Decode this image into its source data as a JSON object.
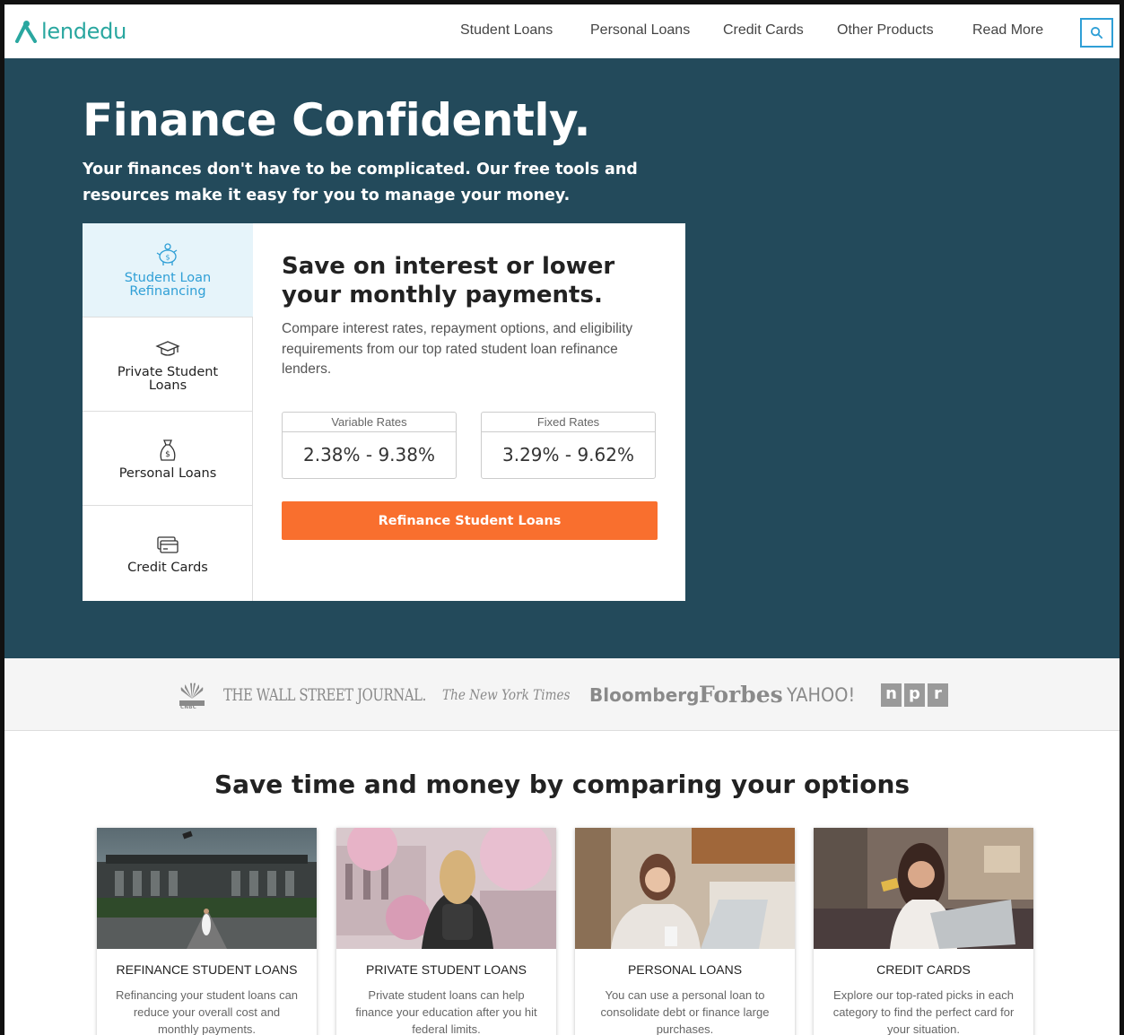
{
  "brand": {
    "name": "lendedu",
    "color": "#2aa7a0"
  },
  "nav": {
    "items": [
      "Student Loans",
      "Personal Loans",
      "Credit Cards",
      "Other Products",
      "Read More"
    ],
    "search_icon": "search-icon"
  },
  "hero": {
    "title": "Finance Confidently.",
    "subtitle_line1": "Your finances don't have to be complicated. Our free tools and",
    "subtitle_line2": "resources make it easy for you to manage your money.",
    "background": "#234a5b"
  },
  "widget": {
    "tabs": [
      {
        "label": "Student Loan Refinancing",
        "icon": "piggy-bank-icon",
        "active": true
      },
      {
        "label": "Private Student Loans",
        "icon": "graduation-cap-icon",
        "active": false
      },
      {
        "label": "Personal Loans",
        "icon": "money-bag-icon",
        "active": false
      },
      {
        "label": "Credit Cards",
        "icon": "credit-card-icon",
        "active": false
      }
    ],
    "panel": {
      "title": "Save on interest or lower your monthly payments.",
      "description": "Compare interest rates, repayment options, and eligibility requirements from our top rated student loan refinance lenders.",
      "rates": [
        {
          "label": "Variable Rates",
          "value": "2.38% - 9.38%"
        },
        {
          "label": "Fixed Rates",
          "value": "3.29% - 9.62%"
        }
      ],
      "cta": "Refinance Student Loans",
      "cta_color": "#f96f2e"
    }
  },
  "press": {
    "logos": [
      "CNBC",
      "THE WALL STREET JOURNAL.",
      "The New York Times",
      "Bloomberg",
      "Forbes",
      "YAHOO!",
      "npr"
    ]
  },
  "compare": {
    "title": "Save time and money by comparing your options",
    "cards": [
      {
        "title": "REFINANCE STUDENT LOANS",
        "desc": "Refinancing your student loans can reduce your overall cost and monthly payments."
      },
      {
        "title": "PRIVATE STUDENT LOANS",
        "desc": "Private student loans can help finance your education after you hit federal limits."
      },
      {
        "title": "PERSONAL LOANS",
        "desc": "You can use a personal loan to consolidate debt or finance large purchases."
      },
      {
        "title": "CREDIT CARDS",
        "desc": "Explore our top-rated picks in each category to find the perfect card for your situation."
      }
    ]
  }
}
